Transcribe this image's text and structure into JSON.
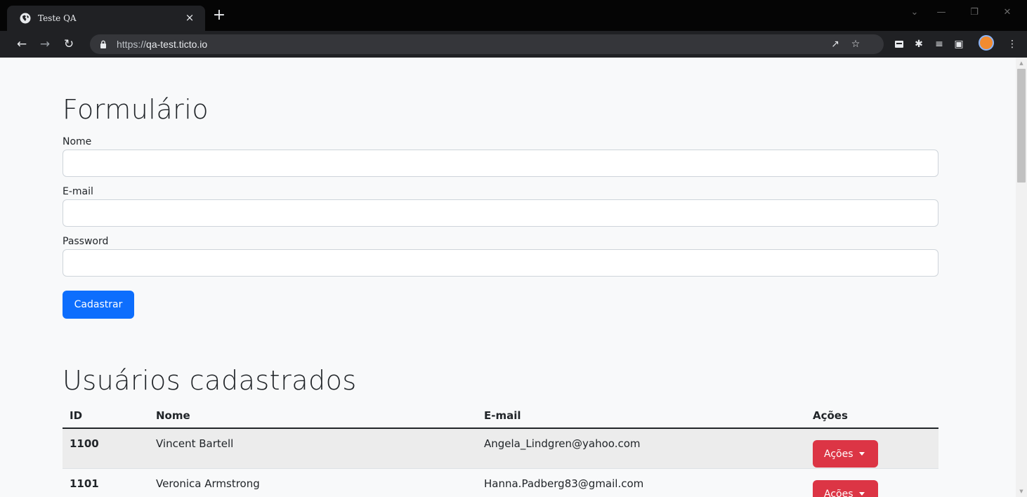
{
  "browser": {
    "tab_title": "Teste QA",
    "tab_close": "×",
    "new_tab": "+",
    "url_protocol": "https://",
    "url_host": "qa-test.ticto.io",
    "icons": [
      "globe-icon",
      "back-icon",
      "forward-icon",
      "reload-icon",
      "lock-icon",
      "share-icon",
      "star-icon",
      "extension-icon",
      "puzzle-icon",
      "media-icon",
      "sidepanel-icon",
      "avatar",
      "menu-icon"
    ]
  },
  "form": {
    "title": "Formulário",
    "name_label": "Nome",
    "name_value": "",
    "email_label": "E-mail",
    "email_value": "",
    "password_label": "Password",
    "password_value": "",
    "submit_label": "Cadastrar"
  },
  "users": {
    "title": "Usuários cadastrados",
    "columns": [
      "ID",
      "Nome",
      "E-mail",
      "Ações"
    ],
    "rows": [
      {
        "id": "1100",
        "name": "Vincent Bartell",
        "email": "Angela_Lindgren@yahoo.com",
        "action": "Ações"
      },
      {
        "id": "1101",
        "name": "Veronica Armstrong",
        "email": "Hanna.Padberg83@gmail.com",
        "action": "Ações"
      }
    ]
  },
  "colors": {
    "primary": "#0d6efd",
    "danger": "#dc3545",
    "page_bg": "#f8f9fa",
    "chrome_bg": "#202124"
  }
}
